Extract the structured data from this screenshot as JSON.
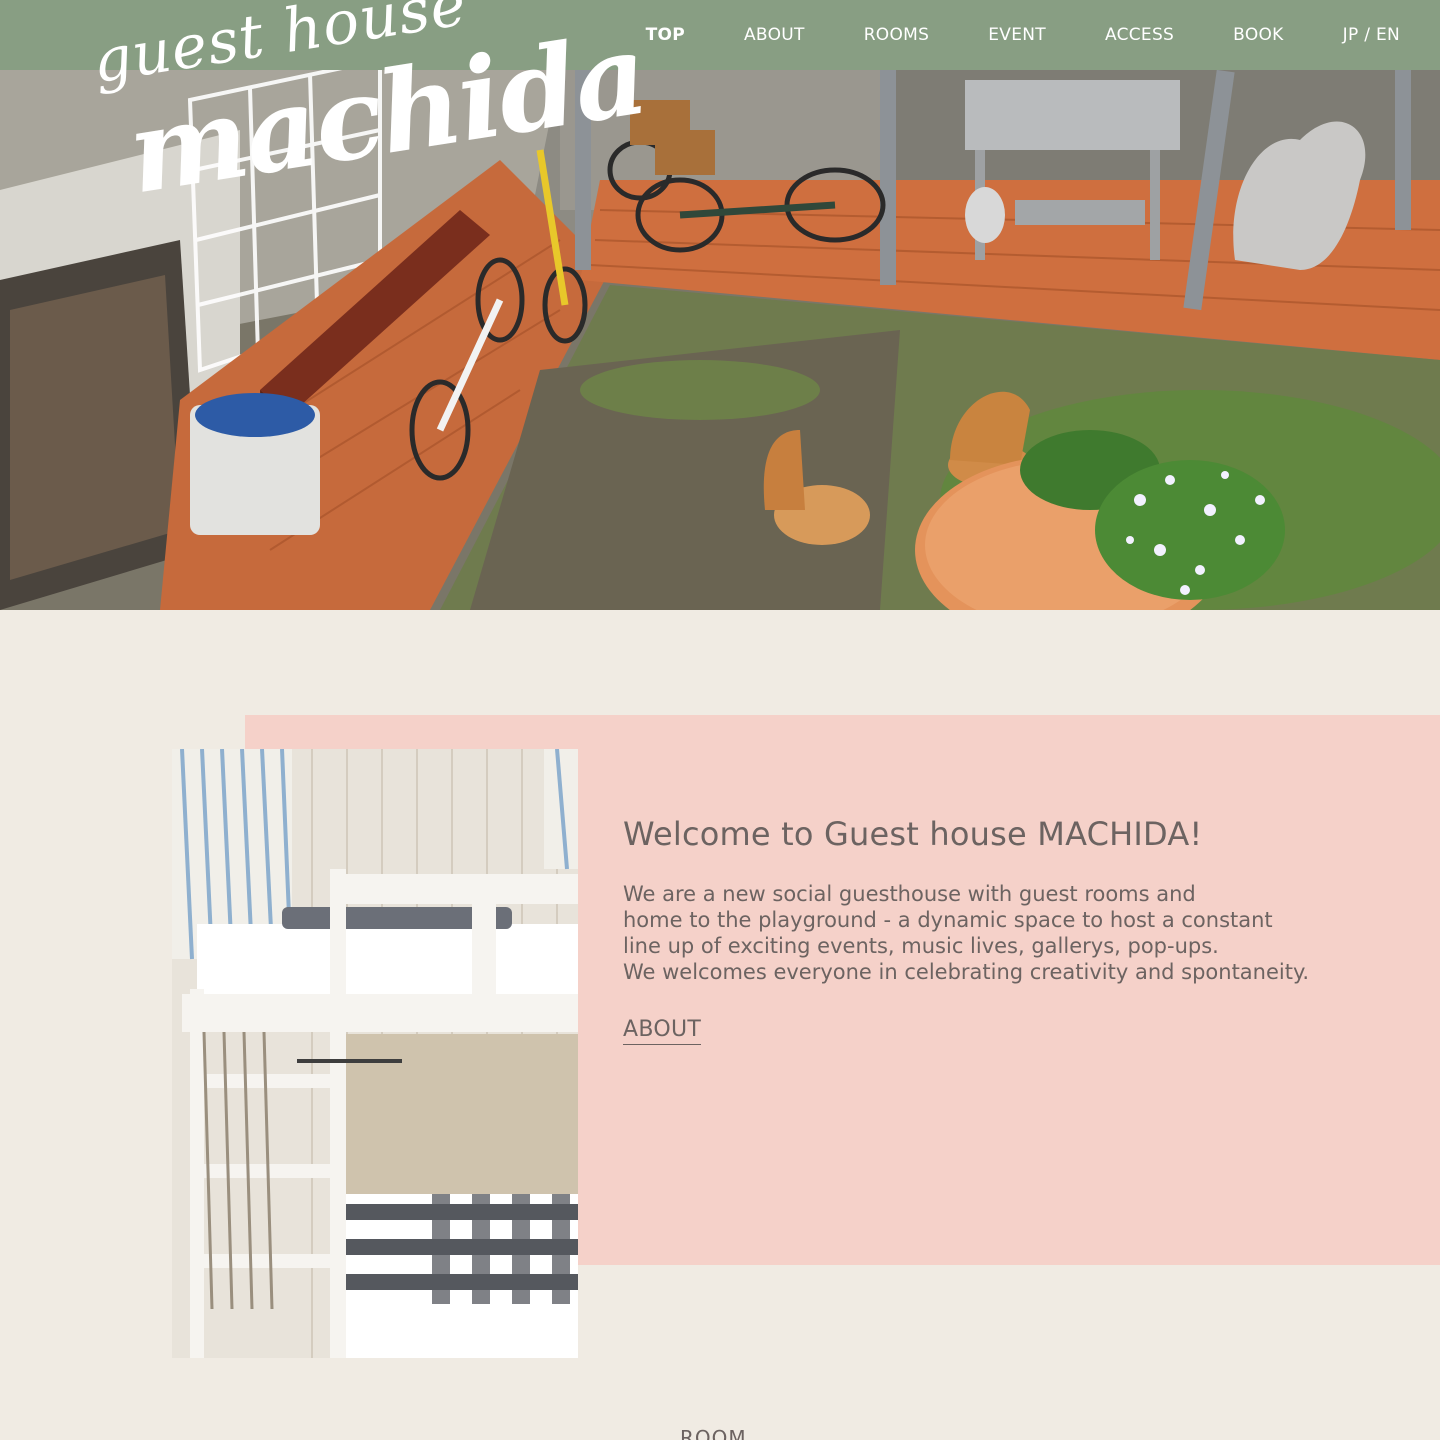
{
  "brand": {
    "line1": "guest house",
    "line2": "machida"
  },
  "nav": {
    "items": [
      {
        "label": "TOP",
        "active": true
      },
      {
        "label": "ABOUT",
        "active": false
      },
      {
        "label": "ROOMS",
        "active": false
      },
      {
        "label": "EVENT",
        "active": false
      },
      {
        "label": "ACCESS",
        "active": false
      },
      {
        "label": "BOOK",
        "active": false
      },
      {
        "label": "JP / EN",
        "active": false
      }
    ]
  },
  "welcome": {
    "title": "Welcome to Guest house MACHIDA!",
    "body": [
      "We are a new social guesthouse with guest rooms and",
      "home to the playground - a dynamic space to host a constant",
      "line up of exciting events, music lives, gallerys, pop-ups.",
      "We welcomes everyone in celebrating creativity and spontaneity."
    ],
    "link": "ABOUT"
  },
  "next_section": {
    "label": "ROOM"
  },
  "colors": {
    "header": "#889e83",
    "background": "#f0ebe3",
    "panel": "#f5d1c9",
    "text": "#6c6361"
  }
}
